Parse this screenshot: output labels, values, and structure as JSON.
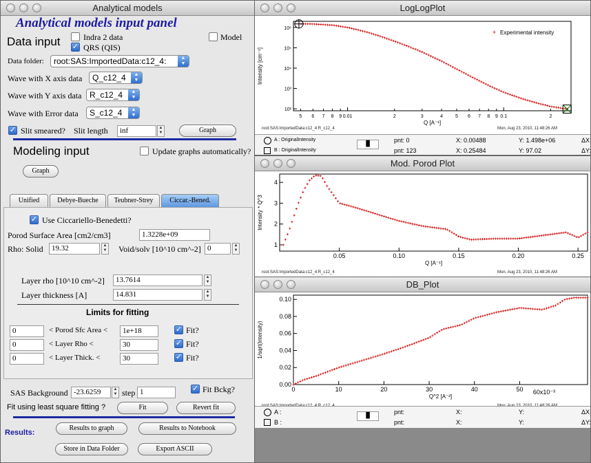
{
  "panel": {
    "window_title": "Analytical models",
    "heading": "Analytical models input panel",
    "data_input": "Data input",
    "indra": "Indra 2 data",
    "qrs": "QRS (QIS)",
    "model": "Model",
    "data_folder_label": "Data folder:",
    "data_folder": "root:SAS:ImportedData:c12_4:",
    "wave_x_label": "Wave with X axis data",
    "wave_x": "Q_c12_4",
    "wave_y_label": "Wave with Y axis data",
    "wave_y": "R_c12_4",
    "wave_e_label": "Wave with Error data",
    "wave_e": "S_c12_4",
    "slit_smeared": "Slit smeared?",
    "slit_length_label": "Slit length",
    "slit_length": "inf",
    "graph_btn": "Graph",
    "modeling_input": "Modeling input",
    "update_graphs": "Update graphs automatically?",
    "graph_btn2": "Graph",
    "tabs": [
      "Unified",
      "Debye-Bueche",
      "Teubner-Strey",
      "Ciccar.-Bened."
    ],
    "use_cb": "Use Ciccariello-Benedetti?",
    "porod_label": "Porod Surface Area [cm2/cm3]",
    "porod_value": "1.3228e+09",
    "rho_label": "Rho:  Solid",
    "rho_solid": "19.32",
    "void_label": "Void/solv [10^10 cm^-2]",
    "void_value": "0",
    "layer_rho_label": "Layer rho [10^10 cm^-2]",
    "layer_rho": "13.7614",
    "layer_thick_label": "Layer thickness [A]",
    "layer_thick": "14.831",
    "limits_title": "Limits for fitting",
    "limits": [
      {
        "low": "0",
        "label": "<  Porod Sfc Area <",
        "high": "1e+18",
        "fit": "Fit?"
      },
      {
        "low": "0",
        "label": "<  Layer Rho       <",
        "high": "30",
        "fit": "Fit?"
      },
      {
        "low": "0",
        "label": "<  Layer Thick.    <",
        "high": "30",
        "fit": "Fit?"
      }
    ],
    "sas_bg_label": "SAS Background",
    "sas_bg": "-23.6259",
    "step_label": "step",
    "step": "1",
    "fit_bckg": "Fit Bckg?",
    "fit_question": "Fit using least square fitting ?",
    "fit_btn": "Fit",
    "revert_btn": "Revert fit",
    "results_label": "Results:",
    "results_graph": "Results to graph",
    "results_notebook": "Results to Notebook",
    "store_folder": "Store in Data Folder",
    "export_ascii": "Export ASCII"
  },
  "loglog": {
    "window_title": "LogLogPlot",
    "ylabel": "Intensity [cm⁻¹]",
    "xlabel": "Q [A⁻¹]",
    "legend": "Experimental intensity",
    "status_left": "root:SAS:ImportedData:c12_4:R_c12_4",
    "status_right": "Mon, Aug 23, 2010, 11:48:26 AM",
    "ytick_labels": [
      "10⁶",
      "10⁵",
      "10⁴",
      "10³",
      "10²"
    ],
    "xtick_labels": [
      "0.01",
      "0.1"
    ]
  },
  "cursor1": {
    "a_label": "A : OriginalIntensity",
    "b_label": "B : OriginalIntensity",
    "a_pnt": "pnt: 0",
    "a_x": "X: 0.00488",
    "a_y": "Y: 1.498e+06",
    "a_dx": "ΔX:",
    "b_pnt": "pnt: 123",
    "b_x": "X: 0.25484",
    "b_y": "Y: 97.02",
    "b_dy": "ΔY:"
  },
  "porod": {
    "window_title": "Mod. Porod Plot",
    "ylabel": "Intensity * Q^3",
    "xlabel": "Q [A⁻¹]",
    "status_left": "root:SAS:ImportedData:c12_4:R_c12_4",
    "status_right": "Mon, Aug 23, 2010, 11:48:26 AM"
  },
  "db": {
    "window_title": "DB_Plot",
    "ylabel": "1/sqrt(Intensity)",
    "xlabel": "Q^2 [A⁻²]",
    "x_multiplier": "60x10⁻³",
    "status_left": "root:SAS:ImportedData:c12_4:R_c12_4",
    "status_right": "Mon, Aug 23, 2010, 11:48:26 AM"
  },
  "cursor2": {
    "a_label": "A :",
    "b_label": "B :",
    "a_pnt": "pnt:",
    "a_x": "X:",
    "a_y": "Y:",
    "a_dx": "ΔX:",
    "b_pnt": "pnt:",
    "b_x": "X:",
    "b_y": "Y:",
    "b_dy": "ΔY:"
  },
  "chart_data": [
    {
      "type": "scatter",
      "title": "LogLogPlot",
      "xlabel": "Q [A^-1]",
      "ylabel": "Intensity [cm^-1]",
      "xscale": "log",
      "yscale": "log",
      "xlim": [
        0.0045,
        0.27
      ],
      "ylim": [
        80,
        2000000
      ],
      "legend": "top-right",
      "series": [
        {
          "name": "Experimental intensity",
          "x": [
            0.00488,
            0.006,
            0.008,
            0.01,
            0.013,
            0.016,
            0.02,
            0.025,
            0.03,
            0.04,
            0.05,
            0.06,
            0.08,
            0.1,
            0.13,
            0.16,
            0.2,
            0.25484
          ],
          "y": [
            1498000,
            1480000,
            1300000,
            1000000,
            620000,
            380000,
            210000,
            110000,
            62000,
            22000,
            9000,
            4300,
            1400,
            650,
            320,
            200,
            130,
            97
          ]
        }
      ]
    },
    {
      "type": "scatter",
      "title": "Mod. Porod Plot",
      "xlabel": "Q [A^-1]",
      "ylabel": "Intensity * Q^3",
      "xlim": [
        0,
        0.258
      ],
      "ylim": [
        0.7,
        4.4
      ],
      "series": [
        {
          "x": [
            0.003,
            0.008,
            0.015,
            0.02,
            0.025,
            0.03,
            0.035,
            0.04,
            0.05,
            0.06,
            0.08,
            0.1,
            0.12,
            0.14,
            0.15,
            0.16,
            0.18,
            0.2,
            0.22,
            0.24,
            0.25,
            0.258
          ],
          "y": [
            1.0,
            1.7,
            2.9,
            3.6,
            4.1,
            4.35,
            4.3,
            3.8,
            3.0,
            2.85,
            2.5,
            2.15,
            1.9,
            1.75,
            1.4,
            1.25,
            1.3,
            1.3,
            1.45,
            1.6,
            1.35,
            1.6
          ]
        }
      ]
    },
    {
      "type": "scatter",
      "title": "DB_Plot",
      "xlabel": "Q^2 [A^-2]",
      "ylabel": "1/sqrt(Intensity)",
      "xlim": [
        0,
        0.065
      ],
      "ylim": [
        0,
        0.105
      ],
      "series": [
        {
          "x": [
            0,
            0.002,
            0.005,
            0.01,
            0.015,
            0.02,
            0.025,
            0.03,
            0.033,
            0.037,
            0.04,
            0.045,
            0.05,
            0.055,
            0.058,
            0.06,
            0.062,
            0.065
          ],
          "y": [
            0,
            0.005,
            0.01,
            0.02,
            0.028,
            0.036,
            0.045,
            0.055,
            0.065,
            0.07,
            0.078,
            0.085,
            0.09,
            0.088,
            0.093,
            0.1,
            0.102,
            0.102
          ]
        }
      ]
    }
  ]
}
